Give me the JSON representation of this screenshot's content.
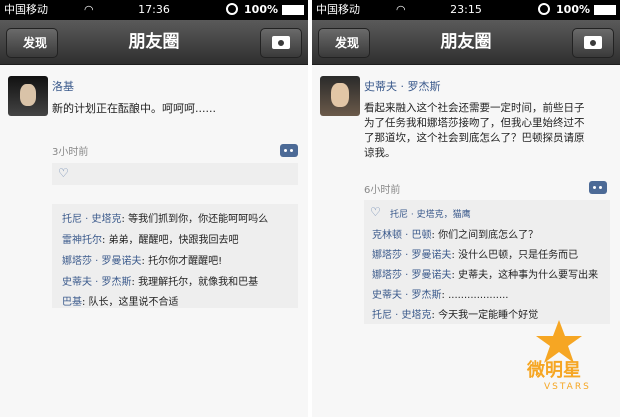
{
  "left": {
    "status": {
      "carrier": "中国移动",
      "time": "17:36",
      "battery": "100%"
    },
    "nav": {
      "back_label": "发现",
      "title": "朋友圈"
    },
    "post": {
      "author": "洛基",
      "text": "新的计划正在酝酿中。呵呵呵......",
      "time_ago": "3小时前"
    },
    "comments": [
      {
        "who": "托尼 · 史塔克",
        "text": ": 等我们抓到你，你还能呵呵吗么"
      },
      {
        "who": "雷神托尔",
        "text": ": 弟弟，醒醒吧，快跟我回去吧"
      },
      {
        "who": "娜塔莎 · 罗曼诺夫",
        "text": ": 托尔你才醒醒吧!"
      },
      {
        "who": "史蒂夫 · 罗杰斯",
        "text": ": 我理解托尔，就像我和巴基"
      },
      {
        "who": "巴基",
        "text": ": 队长，这里说不合适"
      }
    ]
  },
  "right": {
    "status": {
      "carrier": "中国移动",
      "time": "23:15",
      "battery": "100%"
    },
    "nav": {
      "back_label": "发现",
      "title": "朋友圈"
    },
    "post": {
      "author": "史蒂夫 · 罗杰斯",
      "text_lines": [
        "看起来融入这个社会还需要一定时间，前些日子",
        "为了任务我和娜塔莎接吻了，但我心里始终过不",
        "了那道坎，这个社会到底怎么了？巴顿探员请原",
        "谅我。"
      ],
      "time_ago": "6小时前"
    },
    "likers": "托尼 · 史塔克，猫鹰",
    "comments": [
      {
        "who": "克林顿 · 巴顿",
        "text": ": 你们之间到底怎么了？"
      },
      {
        "who": "娜塔莎 · 罗曼诺夫",
        "text": ": 没什么巴顿，只是任务而已"
      },
      {
        "who": "娜塔莎 · 罗曼诺夫",
        "text": ": 史蒂夫，这种事为什么要写出来"
      },
      {
        "who": "史蒂夫 · 罗杰斯",
        "text": ": ..................."
      },
      {
        "who": "托尼 · 史塔克",
        "text": ": 今天我一定能睡个好觉"
      }
    ]
  },
  "watermark": {
    "text": "微明星",
    "sub": "VSTARS"
  },
  "colors": {
    "link": "#3b5a8c",
    "star": "#f6a623",
    "nav": "#3a3a3a"
  }
}
